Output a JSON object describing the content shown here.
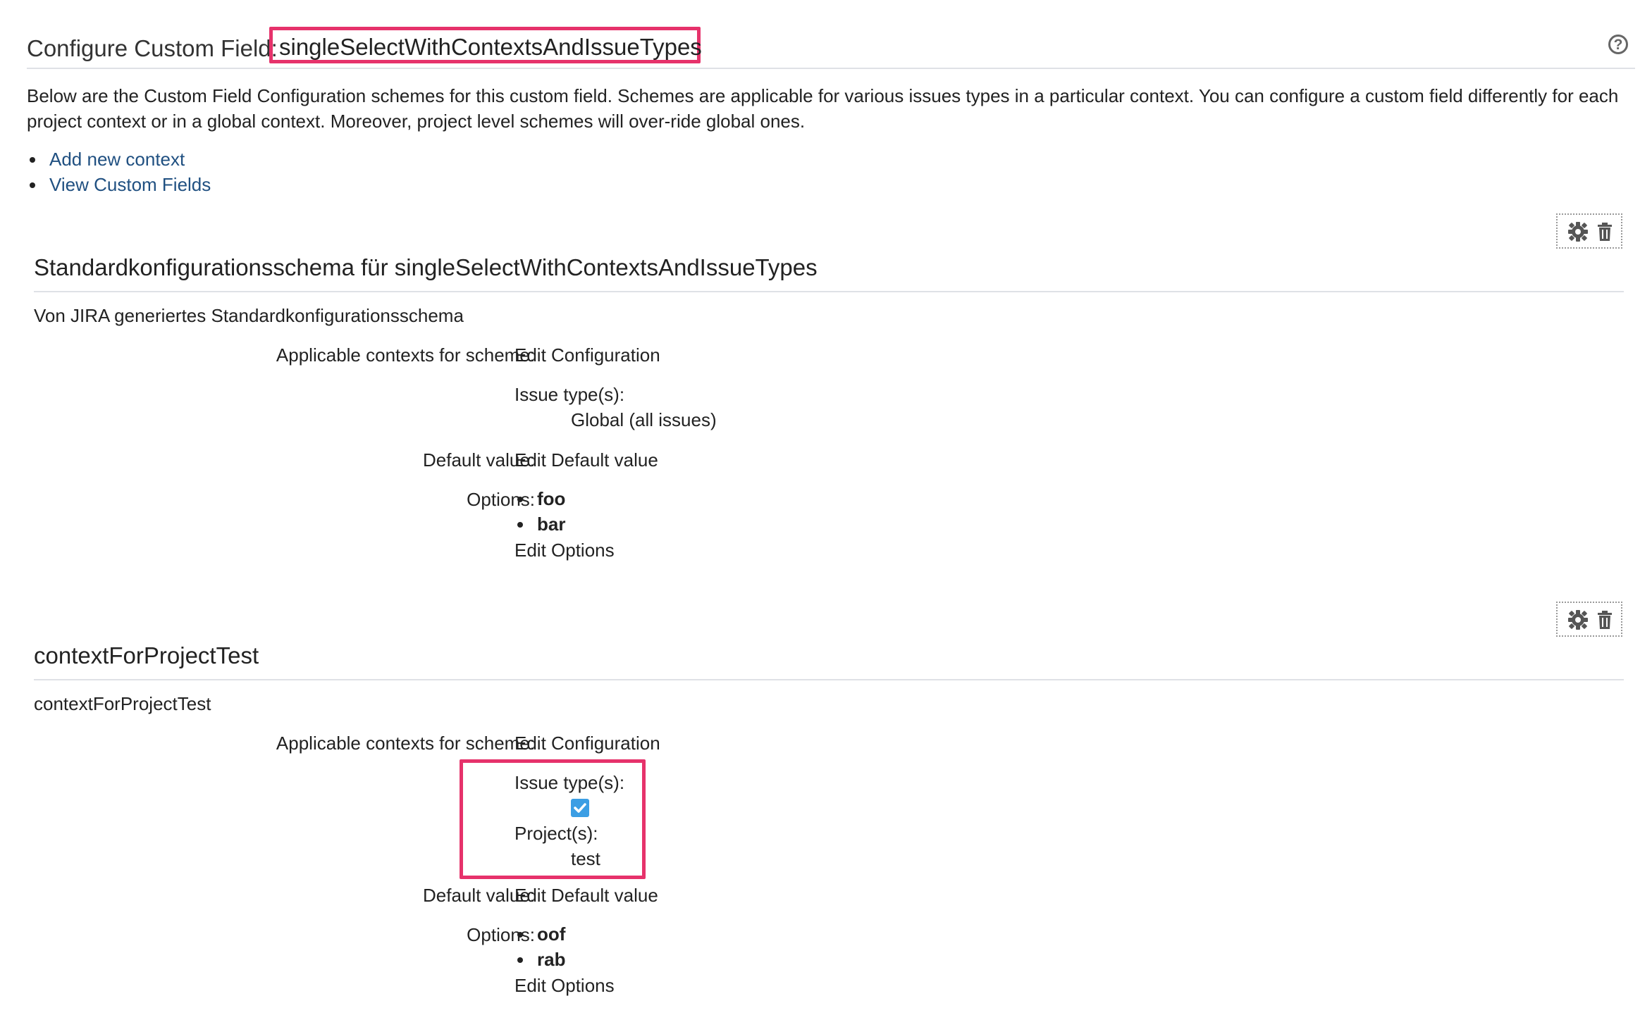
{
  "header": {
    "title_prefix": "Configure Custom Field:",
    "field_name": "singleSelectWithContextsAndIssueTypes",
    "help_icon": "question-circle-icon"
  },
  "description": "Below are the Custom Field Configuration schemes for this custom field. Schemes are applicable for various issues types in a particular context. You can configure a custom field differently for each project context or in a global context. Moreover, project level schemes will over-ride global ones.",
  "top_links": [
    "Add new context",
    "View Custom Fields"
  ],
  "schemes": [
    {
      "title": "Standardkonfigurationsschema für singleSelectWithContextsAndIssueTypes",
      "description": "Von JIRA generiertes Standardkonfigurationsschema",
      "contexts_label": "Applicable contexts for scheme:",
      "edit_configuration": "Edit Configuration",
      "issue_types_label": "Issue type(s):",
      "issue_types_value": "Global (all issues)",
      "default_label": "Default value:",
      "edit_default": "Edit Default value",
      "options_label": "Options:",
      "options": [
        "foo",
        "bar"
      ],
      "edit_options": "Edit Options"
    },
    {
      "title": "contextForProjectTest",
      "description": "contextForProjectTest",
      "contexts_label": "Applicable contexts for scheme:",
      "edit_configuration": "Edit Configuration",
      "issue_types_label": "Issue type(s):",
      "issue_type_icon": "checked-square-icon",
      "projects_label": "Project(s):",
      "project_value": "test",
      "default_label": "Default value:",
      "edit_default": "Edit Default value",
      "options_label": "Options:",
      "options": [
        "oof",
        "rab"
      ],
      "edit_options": "Edit Options"
    }
  ],
  "colors": {
    "link": "#205081",
    "highlight": "#e6326b",
    "checkbox": "#3b9ee4"
  }
}
